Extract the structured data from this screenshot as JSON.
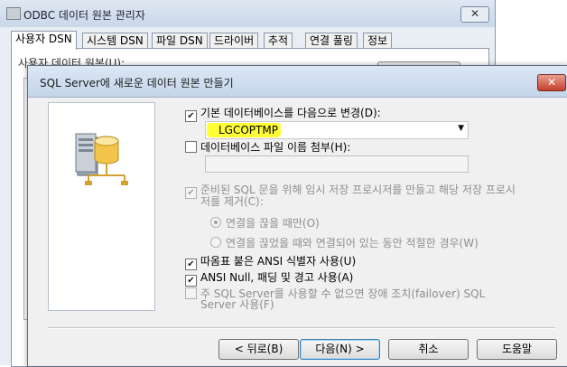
{
  "background_window": {
    "title": "ODBC 데이터 원본 관리자",
    "close_glyph": "✕",
    "tabs": [
      {
        "label": "사용자 DSN",
        "active": true
      },
      {
        "label": "시스템 DSN",
        "active": false
      },
      {
        "label": "파일 DSN",
        "active": false
      },
      {
        "label": "드라이버",
        "active": false
      },
      {
        "label": "추적",
        "active": false
      },
      {
        "label": "연결 풀링",
        "active": false
      },
      {
        "label": "정보",
        "active": false
      }
    ],
    "panel_label": "사용자 데이터 원본(U):"
  },
  "dialog": {
    "title": "SQL Server에 새로운 데이터 원본 만들기",
    "close_glyph": "✕",
    "options": {
      "change_default_db": {
        "label": "기본 데이터베이스를 다음으로 변경(D):",
        "checked": true,
        "mark": "✔"
      },
      "default_db_value": "LGCOPTMP",
      "attach_db_file": {
        "label": "데이터베이스 파일 이름 첨부(H):",
        "checked": false
      },
      "create_temp_procs": {
        "label_line1": "준비된 SQL 문을 위해 임시 저장 프로시저를 만들고 해당 저장 프로시",
        "label_line2": "저를 제거(C):",
        "checked": true,
        "disabled": true,
        "mark": "✔"
      },
      "radio_on_disconnect": {
        "label": "연결을 끊을 때만(O)",
        "selected": true
      },
      "radio_on_disconnect_and_while": {
        "label": "연결을 끊었을 때와 연결되어 있는 동안 적절한 경우(W)",
        "selected": false
      },
      "quoted_identifiers": {
        "label": "따옴표 붙은 ANSI 식별자 사용(U)",
        "checked": true,
        "mark": "✔"
      },
      "ansi_nulls": {
        "label": "ANSI Null, 패딩 및 경고 사용(A)",
        "checked": true,
        "mark": "✔"
      },
      "failover": {
        "label_line1": "주 SQL Server를 사용할 수 없으면 장애 조치(failover) SQL",
        "label_line2": "Server 사용(F)",
        "checked": false,
        "disabled": true
      }
    },
    "buttons": {
      "back": "< 뒤로(B)",
      "next": "다음(N) >",
      "cancel": "취소",
      "help": "도움말"
    }
  },
  "colors": {
    "highlight": "#ffff33",
    "dialog_bg": "#f0f0f0",
    "title_gradient": "#c4d5ea",
    "close_red": "#c4402a"
  }
}
